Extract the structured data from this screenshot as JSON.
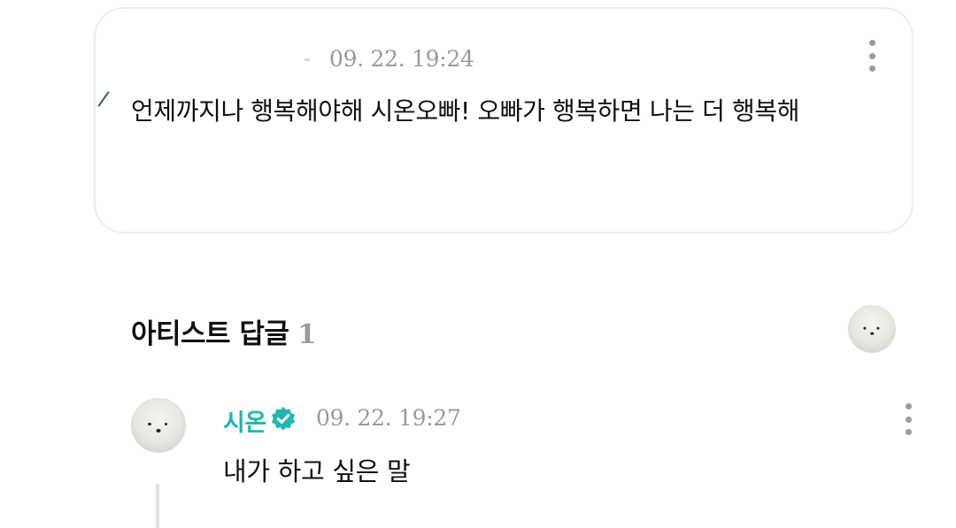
{
  "comment": {
    "date": "09. 22. 19:24",
    "text": "언제까지나 행복해야해 시온오빠! 오빠가 행복하면 나는 더 행복해",
    "more_icon": "more-vertical-icon"
  },
  "artist_replies": {
    "title": "아티스트 답글",
    "count": "1"
  },
  "reply": {
    "author": "시온",
    "verified_icon": "verified-badge-icon",
    "date": "09. 22. 19:27",
    "text": "내가 하고 싶은 말",
    "more_icon": "more-vertical-icon"
  },
  "colors": {
    "accent": "#1fb7b0",
    "muted": "#9a9a9a",
    "border": "#ededed"
  }
}
